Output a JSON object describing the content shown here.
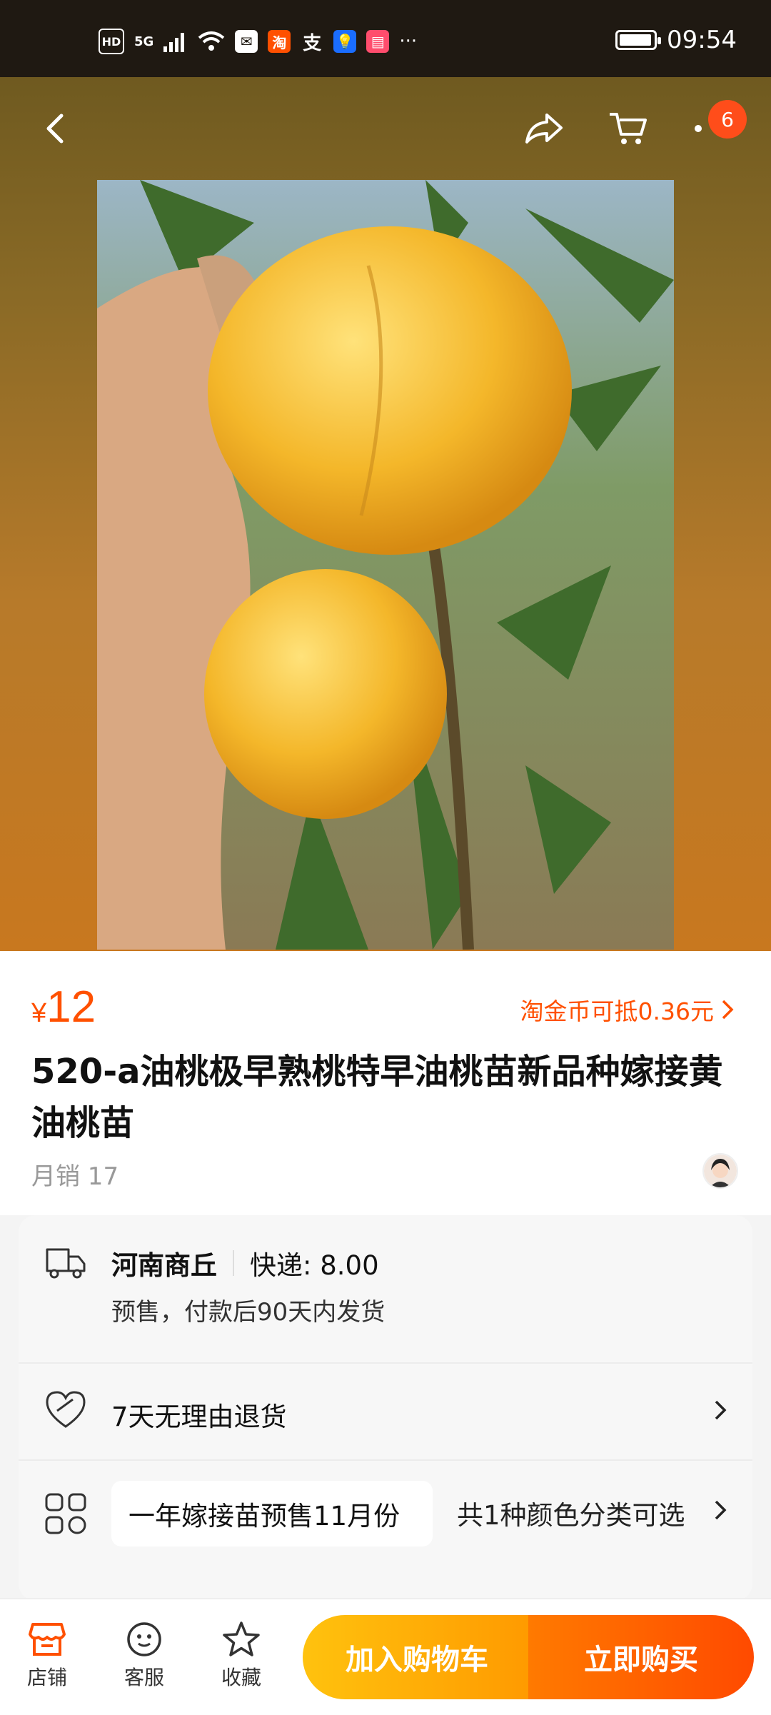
{
  "status_bar": {
    "time": "09:54",
    "hd": "HD",
    "net": "5G",
    "app_icons": [
      "淘",
      "支"
    ],
    "more": "···"
  },
  "nav": {
    "cart_badge": "6"
  },
  "product": {
    "currency": "¥",
    "price": "12",
    "coin_text": "淘金币可抵0.36元",
    "title": "520-a油桃极早熟桃特早油桃苗新品种嫁接黄油桃苗",
    "monthly_sales": "月销 17"
  },
  "shipping": {
    "location": "河南商丘",
    "express": "快递: 8.00",
    "presale": "预售，付款后90天内发货"
  },
  "service": {
    "return_policy": "7天无理由退货"
  },
  "variant": {
    "option": "一年嫁接苗预售11月份",
    "count": "共1种颜色分类可选"
  },
  "bottom_bar": {
    "store": "店铺",
    "service": "客服",
    "favorite": "收藏",
    "add_to_cart": "加入购物车",
    "buy_now": "立即购买"
  },
  "colors": {
    "accent": "#ff5000",
    "cart_button": "#ffb000",
    "buy_button": "#ff5a00"
  }
}
